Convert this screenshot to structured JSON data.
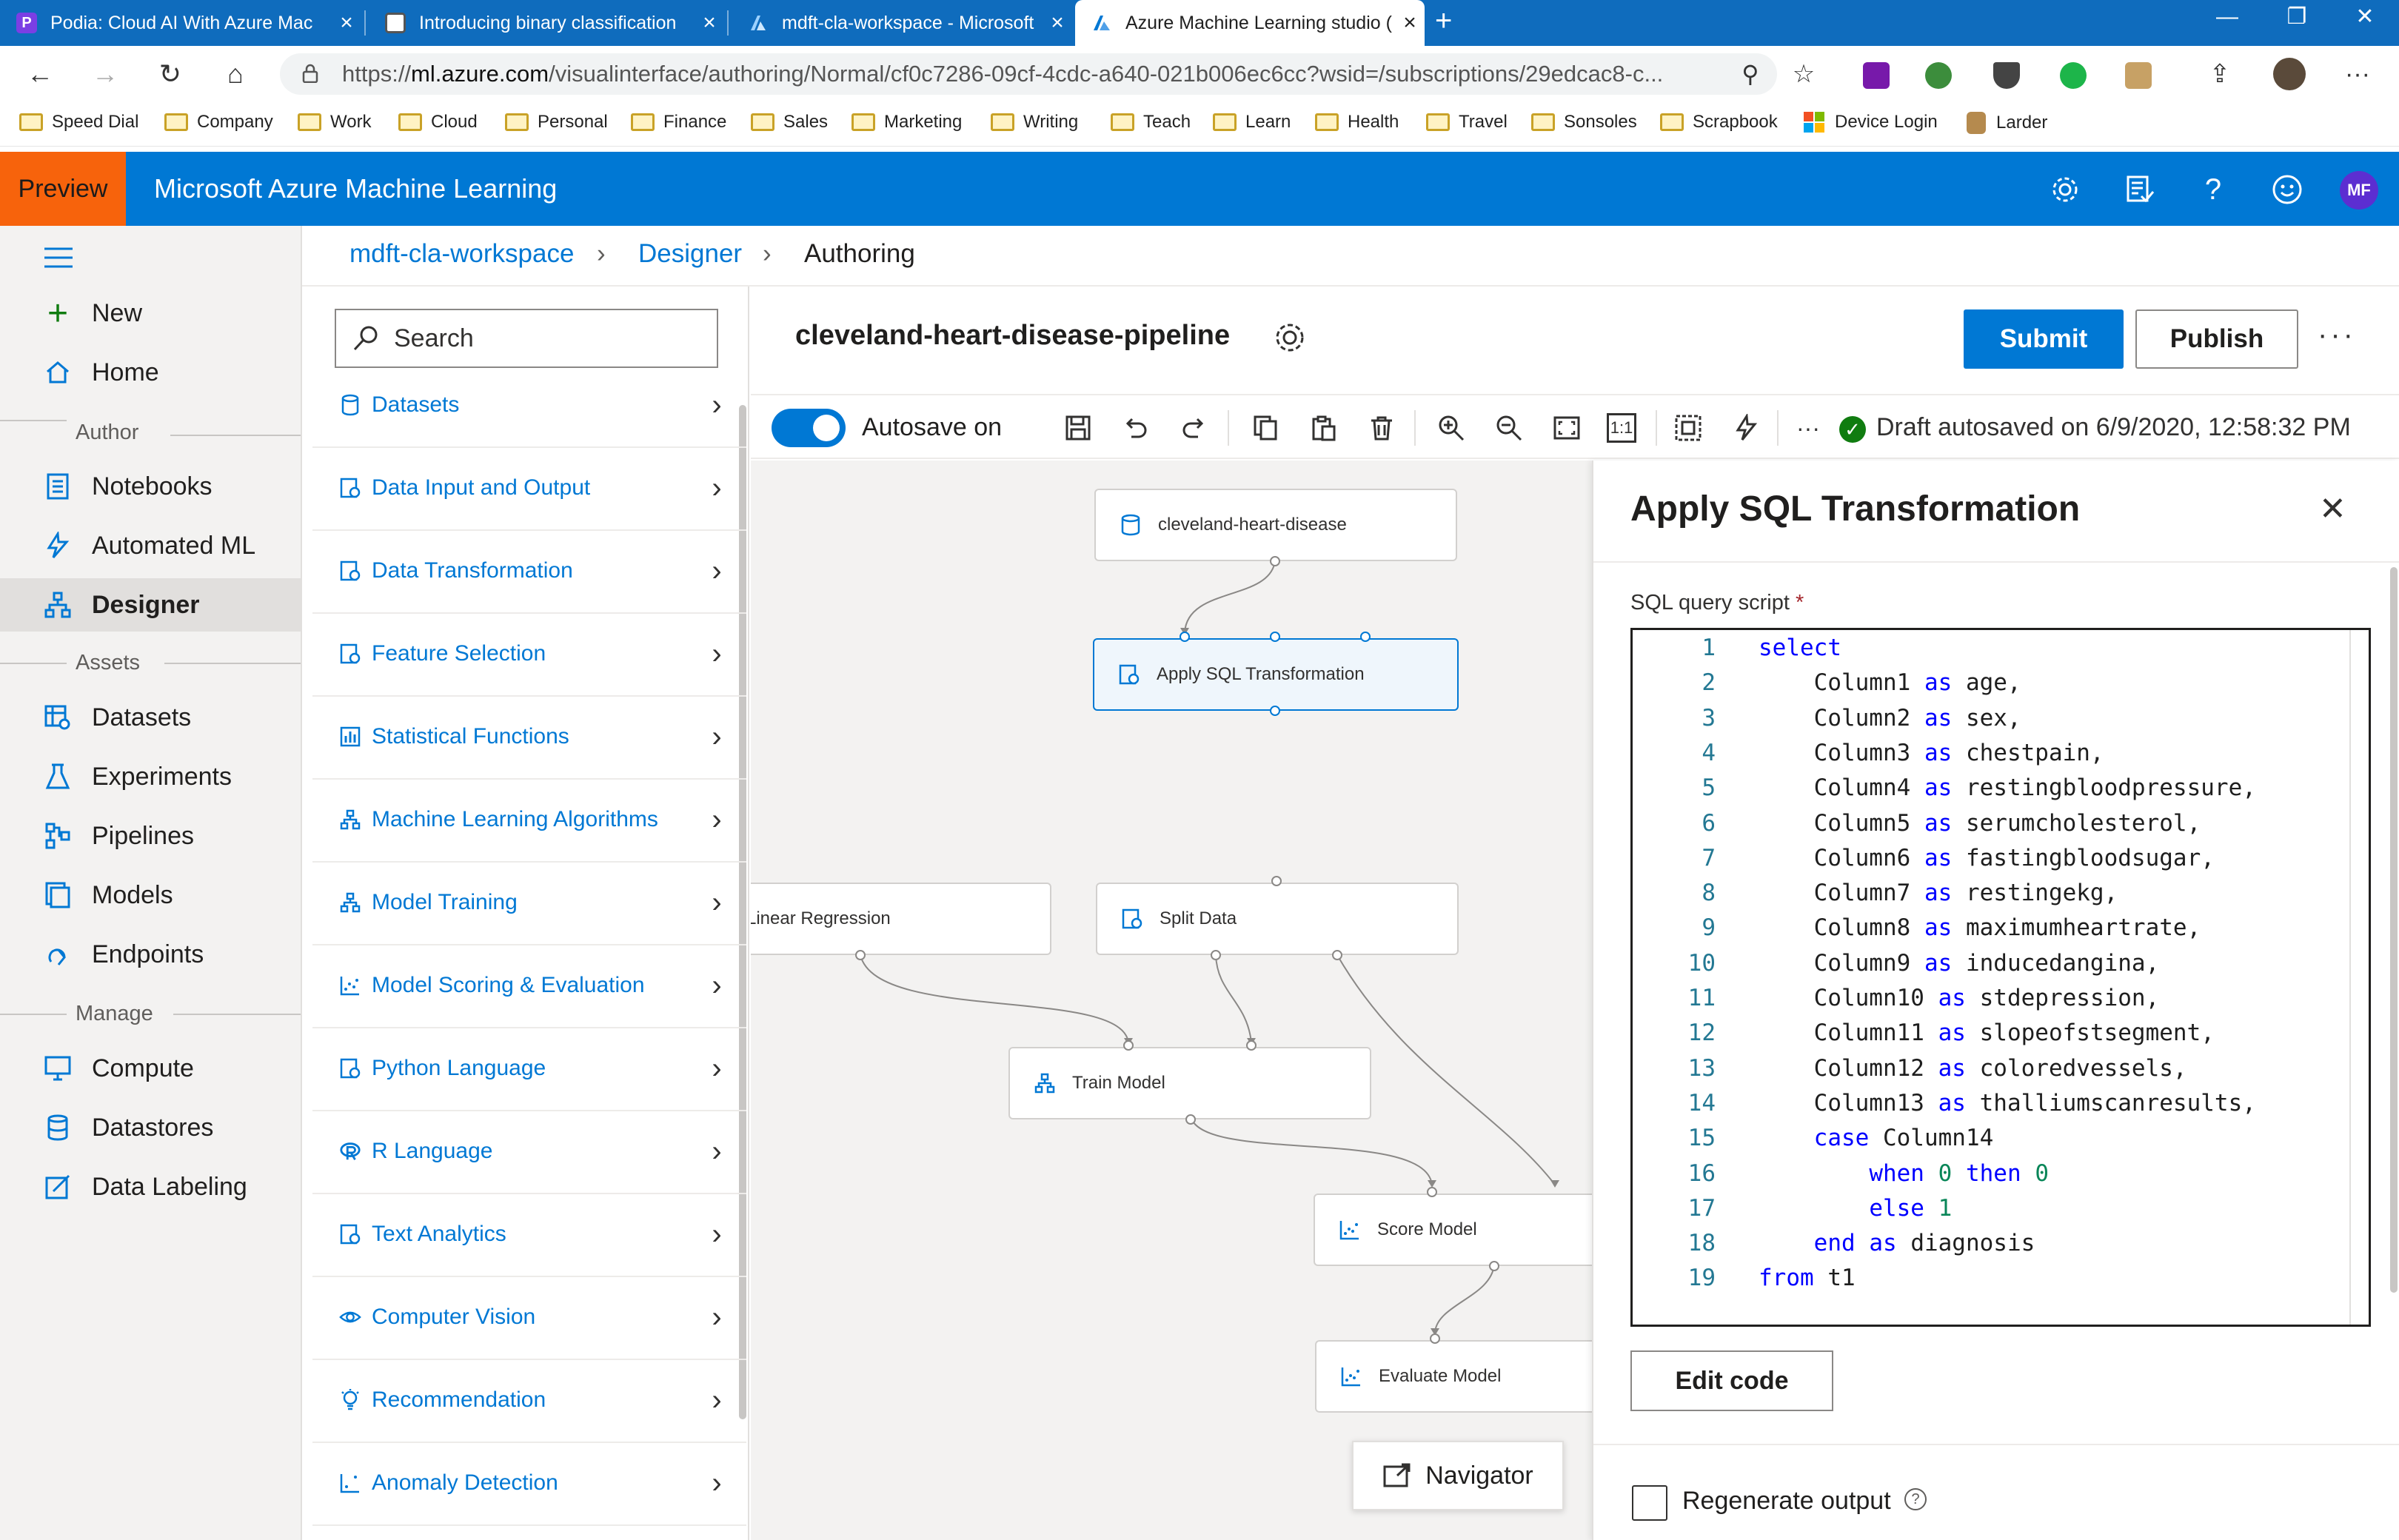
{
  "browser": {
    "tabs": [
      {
        "label": "Podia: Cloud AI With Azure Mac",
        "favicon_color": "#7b3fe4",
        "favicon_letter": "P"
      },
      {
        "label": "Introducing binary classification",
        "favicon_color": "#555555",
        "favicon_letter": ""
      },
      {
        "label": "mdft-cla-workspace - Microsoft",
        "favicon_color": "#1f4fb5",
        "favicon_letter": ""
      },
      {
        "label": "Azure Machine Learning studio (",
        "favicon_color": "#0078d4",
        "favicon_letter": ""
      }
    ],
    "new_tab": "+",
    "window_controls": {
      "minimize": "—",
      "restore": "❐",
      "close": "✕"
    },
    "address": {
      "scheme": "https://",
      "host": "ml.azure.com",
      "path": "/visualinterface/authoring/Normal/cf0c7286-09cf-4cdc-a640-021b006ec6cc?wsid=/subscriptions/29edcac8-c..."
    },
    "nav": {
      "back": "←",
      "forward": "→",
      "refresh": "↻",
      "home": "⌂"
    },
    "toolbar_icons": [
      "zoom-icon",
      "favorite-star-icon",
      "onenote-icon",
      "extension-icon",
      "shield-extension-icon",
      "extension-b-icon",
      "extension-box-icon",
      "share-icon",
      "profile-photo",
      "more-icon"
    ],
    "favorites": [
      {
        "label": "Speed Dial",
        "icon": "folder-icon"
      },
      {
        "label": "Company",
        "icon": "folder-icon"
      },
      {
        "label": "Work",
        "icon": "folder-icon"
      },
      {
        "label": "Cloud",
        "icon": "folder-icon"
      },
      {
        "label": "Personal",
        "icon": "folder-icon"
      },
      {
        "label": "Finance",
        "icon": "folder-icon"
      },
      {
        "label": "Sales",
        "icon": "folder-icon"
      },
      {
        "label": "Marketing",
        "icon": "folder-icon"
      },
      {
        "label": "Writing",
        "icon": "folder-icon"
      },
      {
        "label": "Teach",
        "icon": "folder-icon"
      },
      {
        "label": "Learn",
        "icon": "folder-icon"
      },
      {
        "label": "Health",
        "icon": "folder-icon"
      },
      {
        "label": "Travel",
        "icon": "folder-icon"
      },
      {
        "label": "Sonsoles",
        "icon": "folder-icon"
      },
      {
        "label": "Scrapbook",
        "icon": "folder-icon"
      },
      {
        "label": "Device Login",
        "icon": "windows-logo-icon"
      },
      {
        "label": "Larder",
        "icon": "larder-icon"
      }
    ]
  },
  "app": {
    "preview_label": "Preview",
    "title": "Microsoft Azure Machine Learning",
    "header_icons": [
      "settings-icon",
      "notebook-feedback-icon",
      "help-icon",
      "smiley-icon"
    ],
    "avatar_initials": "MF",
    "accent_color": "#0078d4",
    "preview_color": "#f7630c"
  },
  "leftnav": {
    "menu_icon": "hamburger-icon",
    "top_items": [
      {
        "label": "New",
        "icon": "plus-icon"
      },
      {
        "label": "Home",
        "icon": "home-icon"
      }
    ],
    "sections": [
      {
        "heading": "Author",
        "items": [
          {
            "label": "Notebooks",
            "icon": "notebook-icon"
          },
          {
            "label": "Automated ML",
            "icon": "automl-icon"
          },
          {
            "label": "Designer",
            "icon": "designer-icon",
            "selected": true
          }
        ]
      },
      {
        "heading": "Assets",
        "items": [
          {
            "label": "Datasets",
            "icon": "datasets-icon"
          },
          {
            "label": "Experiments",
            "icon": "flask-icon"
          },
          {
            "label": "Pipelines",
            "icon": "pipelines-icon"
          },
          {
            "label": "Models",
            "icon": "models-icon"
          },
          {
            "label": "Endpoints",
            "icon": "endpoints-icon"
          }
        ]
      },
      {
        "heading": "Manage",
        "items": [
          {
            "label": "Compute",
            "icon": "compute-icon"
          },
          {
            "label": "Datastores",
            "icon": "datastore-icon"
          },
          {
            "label": "Data Labeling",
            "icon": "labeling-icon"
          }
        ]
      }
    ]
  },
  "breadcrumb": {
    "workspace": "mdft-cla-workspace",
    "designer": "Designer",
    "current": "Authoring",
    "separator": "›"
  },
  "palette": {
    "search_placeholder": "Search",
    "modules": [
      {
        "label": "Datasets",
        "icon": "cylinder-icon"
      },
      {
        "label": "Data Input and Output",
        "icon": "data-io-icon"
      },
      {
        "label": "Data Transformation",
        "icon": "data-transform-icon"
      },
      {
        "label": "Feature Selection",
        "icon": "feature-selection-icon"
      },
      {
        "label": "Statistical Functions",
        "icon": "bar-chart-icon"
      },
      {
        "label": "Machine Learning Algorithms",
        "icon": "algorithm-icon"
      },
      {
        "label": "Model Training",
        "icon": "model-training-icon"
      },
      {
        "label": "Model Scoring & Evaluation",
        "icon": "scatter-icon"
      },
      {
        "label": "Python Language",
        "icon": "python-icon"
      },
      {
        "label": "R Language",
        "icon": "r-icon"
      },
      {
        "label": "Text Analytics",
        "icon": "text-analytics-icon"
      },
      {
        "label": "Computer Vision",
        "icon": "eye-icon"
      },
      {
        "label": "Recommendation",
        "icon": "lightbulb-icon"
      },
      {
        "label": "Anomaly Detection",
        "icon": "anomaly-icon"
      }
    ]
  },
  "pipeline": {
    "title": "cleveland-heart-disease-pipeline",
    "submit_label": "Submit",
    "publish_label": "Publish",
    "more_label": "···"
  },
  "toolbar": {
    "autosave_label": "Autosave on",
    "autosave_on": true,
    "tools": [
      "save-icon",
      "undo-icon",
      "redo-icon",
      "copy-icon",
      "paste-icon",
      "delete-icon",
      "zoom-in-icon",
      "zoom-out-icon",
      "fit-to-screen-icon",
      "actual-size-icon",
      "grid-select-icon",
      "quick-action-icon",
      "more-icon"
    ],
    "actual_size_label": "1:1",
    "more_label": "···",
    "draft_status": "Draft autosaved on 6/9/2020, 12:58:32 PM",
    "status_color": "#107c10"
  },
  "canvas": {
    "nodes": [
      {
        "id": "dataset",
        "label": "cleveland-heart-disease",
        "icon": "dataset-icon"
      },
      {
        "id": "sql",
        "label": "Apply SQL Transformation",
        "icon": "sql-transform-icon",
        "selected": true
      },
      {
        "id": "linreg",
        "label": "Linear Regression",
        "icon": ""
      },
      {
        "id": "split",
        "label": "Split Data",
        "icon": "split-data-icon"
      },
      {
        "id": "train",
        "label": "Train Model",
        "icon": "train-model-icon"
      },
      {
        "id": "score",
        "label": "Score Model",
        "icon": "score-model-icon"
      },
      {
        "id": "evaluate",
        "label": "Evaluate Model",
        "icon": "evaluate-model-icon"
      }
    ],
    "navigator_label": "Navigator"
  },
  "properties": {
    "title": "Apply SQL Transformation",
    "close_label": "✕",
    "sql_label": "SQL query script",
    "required_mark": "*",
    "sql_lines": [
      [
        [
          "kw",
          "select"
        ]
      ],
      [
        [
          "idt",
          "    Column1 "
        ],
        [
          "kw",
          "as"
        ],
        [
          "idt",
          " age,"
        ]
      ],
      [
        [
          "idt",
          "    Column2 "
        ],
        [
          "kw",
          "as"
        ],
        [
          "idt",
          " sex,"
        ]
      ],
      [
        [
          "idt",
          "    Column3 "
        ],
        [
          "kw",
          "as"
        ],
        [
          "idt",
          " chestpain,"
        ]
      ],
      [
        [
          "idt",
          "    Column4 "
        ],
        [
          "kw",
          "as"
        ],
        [
          "idt",
          " restingbloodpressure,"
        ]
      ],
      [
        [
          "idt",
          "    Column5 "
        ],
        [
          "kw",
          "as"
        ],
        [
          "idt",
          " serumcholesterol,"
        ]
      ],
      [
        [
          "idt",
          "    Column6 "
        ],
        [
          "kw",
          "as"
        ],
        [
          "idt",
          " fastingbloodsugar,"
        ]
      ],
      [
        [
          "idt",
          "    Column7 "
        ],
        [
          "kw",
          "as"
        ],
        [
          "idt",
          " restingekg,"
        ]
      ],
      [
        [
          "idt",
          "    Column8 "
        ],
        [
          "kw",
          "as"
        ],
        [
          "idt",
          " maximumheartrate,"
        ]
      ],
      [
        [
          "idt",
          "    Column9 "
        ],
        [
          "kw",
          "as"
        ],
        [
          "idt",
          " inducedangina,"
        ]
      ],
      [
        [
          "idt",
          "    Column10 "
        ],
        [
          "kw",
          "as"
        ],
        [
          "idt",
          " stdepression,"
        ]
      ],
      [
        [
          "idt",
          "    Column11 "
        ],
        [
          "kw",
          "as"
        ],
        [
          "idt",
          " slopeofstsegment,"
        ]
      ],
      [
        [
          "idt",
          "    Column12 "
        ],
        [
          "kw",
          "as"
        ],
        [
          "idt",
          " coloredvessels,"
        ]
      ],
      [
        [
          "idt",
          "    Column13 "
        ],
        [
          "kw",
          "as"
        ],
        [
          "idt",
          " thalliumscanresults,"
        ]
      ],
      [
        [
          "idt",
          "    "
        ],
        [
          "kw",
          "case"
        ],
        [
          "idt",
          " Column14"
        ]
      ],
      [
        [
          "idt",
          "        "
        ],
        [
          "kw",
          "when"
        ],
        [
          "idt",
          " "
        ],
        [
          "num",
          "0"
        ],
        [
          "idt",
          " "
        ],
        [
          "kw",
          "then"
        ],
        [
          "idt",
          " "
        ],
        [
          "num",
          "0"
        ]
      ],
      [
        [
          "idt",
          "        "
        ],
        [
          "kw",
          "else"
        ],
        [
          "idt",
          " "
        ],
        [
          "num",
          "1"
        ]
      ],
      [
        [
          "idt",
          "    "
        ],
        [
          "kw",
          "end"
        ],
        [
          "idt",
          " "
        ],
        [
          "kw",
          "as"
        ],
        [
          "idt",
          " diagnosis"
        ]
      ],
      [
        [
          "kw",
          "from"
        ],
        [
          "idt",
          " t1"
        ]
      ]
    ],
    "edit_code_label": "Edit code",
    "regenerate_label": "Regenerate output",
    "regenerate_checked": false,
    "info_glyph": "?"
  }
}
